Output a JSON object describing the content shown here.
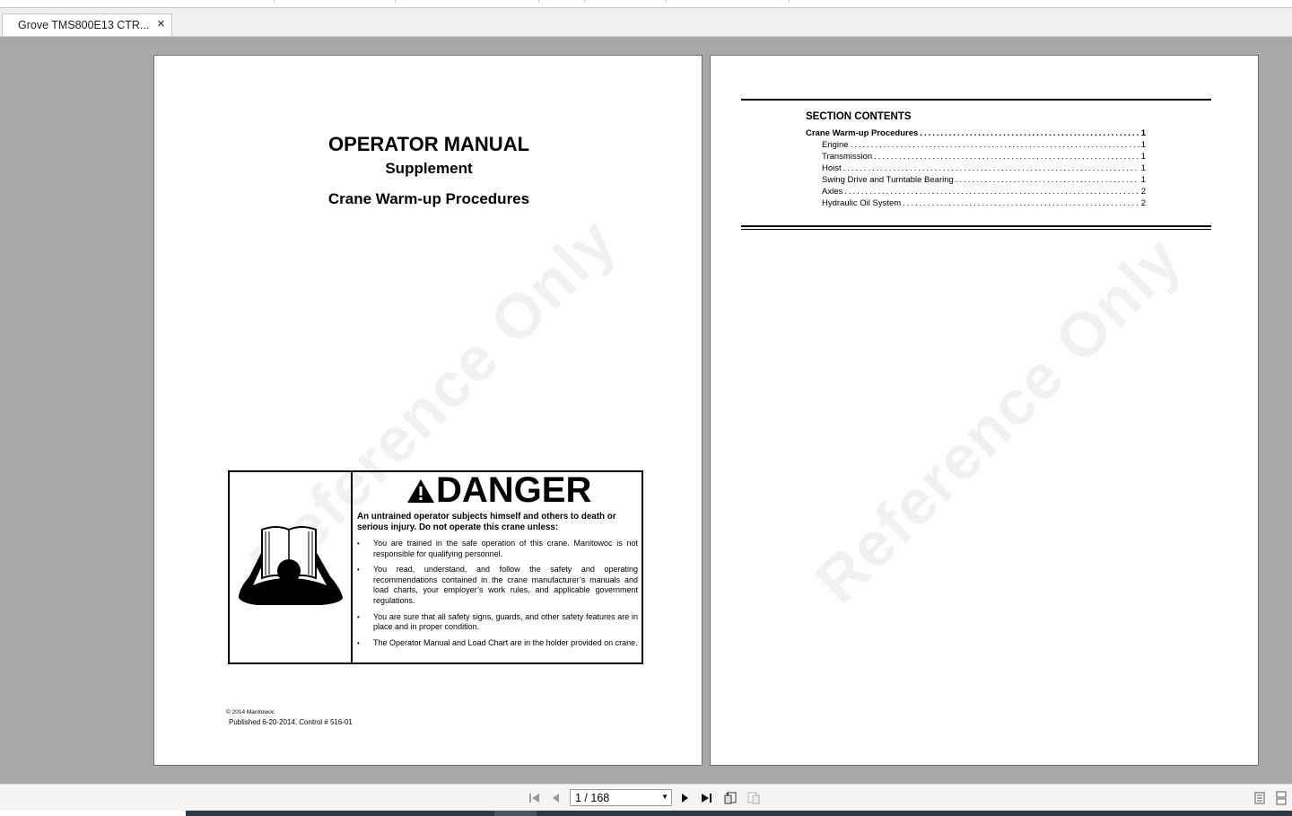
{
  "tab": {
    "title": "Grove TMS800E13 CTR...",
    "close": "×"
  },
  "left_page": {
    "watermark": "Reference Only",
    "title": "OPERATOR MANUAL",
    "subtitle": "Supplement",
    "section": "Crane Warm-up Procedures",
    "danger": {
      "heading": "DANGER",
      "intro": "An untrained operator subjects himself and others to death or serious injury. Do not operate this crane unless:",
      "bullets": [
        "You are trained in the safe operation of this crane. Manitowoc is not responsible for qualifying personnel.",
        "You read, understand, and follow the safety and operating recommendations contained in the crane manufacturer’s manuals and load charts, your employer’s work rules, and applicable government regulations.",
        "You are sure that all safety signs, guards, and other safety features are in place and in proper condition.",
        "The Operator Manual and Load Chart are in the holder provided on crane."
      ]
    },
    "copyright": "© 2014 Manitowoc",
    "published": "Published 6-20-2014, Control # 516-01"
  },
  "right_page": {
    "watermark": "Reference Only",
    "toc_title": "SECTION CONTENTS",
    "toc": [
      {
        "label": "Crane Warm-up Procedures",
        "page": "1",
        "main": true
      },
      {
        "label": "Engine",
        "page": "1"
      },
      {
        "label": "Transmission",
        "page": "1"
      },
      {
        "label": "Hoist",
        "page": "1"
      },
      {
        "label": "Swing Drive and Turntable Bearing",
        "page": "1"
      },
      {
        "label": "Axles",
        "page": "2"
      },
      {
        "label": "Hydraulic Oil System",
        "page": "2"
      }
    ]
  },
  "navigation": {
    "page_indicator": "1 / 168"
  },
  "colors": {
    "viewer_bg": "#a9a9a9",
    "status_bar": "#2b3a45"
  },
  "icons": [
    "first-page-icon",
    "previous-page-icon",
    "next-page-icon",
    "last-page-icon",
    "previous-view-icon",
    "next-view-icon",
    "single-page-view-icon",
    "continuous-view-icon",
    "close-icon",
    "warning-triangle-icon",
    "reading-operator-icon"
  ]
}
